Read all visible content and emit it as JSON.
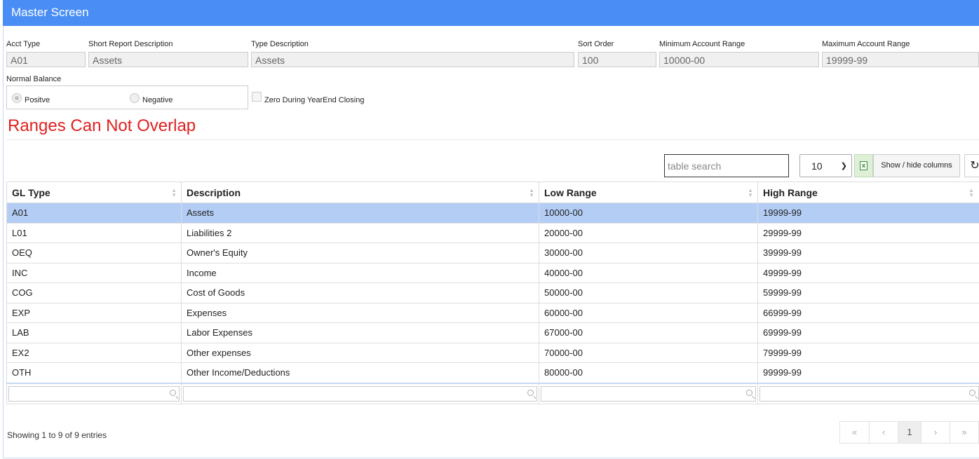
{
  "window": {
    "title": "Master Screen"
  },
  "form": {
    "acct_type": {
      "label": "Acct Type",
      "value": "A01"
    },
    "short_desc": {
      "label": "Short Report Description",
      "value": "Assets"
    },
    "type_desc": {
      "label": "Type Description",
      "value": "Assets"
    },
    "sort_order": {
      "label": "Sort Order",
      "value": "100"
    },
    "min_range": {
      "label": "Minimum Account Range",
      "value": "10000-00"
    },
    "max_range": {
      "label": "Maximum Account Range",
      "value": "19999-99"
    },
    "normal_balance": {
      "label": "Normal Balance",
      "positive": "Positve",
      "negative": "Negative",
      "selected": "Positve"
    },
    "zero_closing": {
      "label": "Zero During YearEnd Closing",
      "checked": false
    }
  },
  "warning": "Ranges Can Not Overlap",
  "toolbar": {
    "search_placeholder": "table search",
    "page_size": "10",
    "columns_button": "Show / hide columns",
    "excel_icon": "excel-icon",
    "refresh_icon": "refresh-icon"
  },
  "table": {
    "headers": [
      "GL Type",
      "Description",
      "Low Range",
      "High Range"
    ],
    "rows": [
      [
        "A01",
        "Assets",
        "10000-00",
        "19999-99"
      ],
      [
        "L01",
        "Liabilities 2",
        "20000-00",
        "29999-99"
      ],
      [
        "OEQ",
        "Owner's Equity",
        "30000-00",
        "39999-99"
      ],
      [
        "INC",
        "Income",
        "40000-00",
        "49999-99"
      ],
      [
        "COG",
        "Cost of Goods",
        "50000-00",
        "59999-99"
      ],
      [
        "EXP",
        "Expenses",
        "60000-00",
        "66999-99"
      ],
      [
        "LAB",
        "Labor Expenses",
        "67000-00",
        "69999-99"
      ],
      [
        "EX2",
        "Other expenses",
        "70000-00",
        "79999-99"
      ],
      [
        "OTH",
        "Other Income/Deductions",
        "80000-00",
        "99999-99"
      ]
    ],
    "selected_row": 0
  },
  "footer": {
    "info": "Showing 1 to 9 of 9 entries",
    "pager": {
      "first": "«",
      "prev": "‹",
      "current": "1",
      "next": "›",
      "last": "»"
    }
  },
  "colors": {
    "titlebar": "#4a8ef5",
    "warning": "#e02020",
    "selected_row": "#b3cdf5"
  }
}
